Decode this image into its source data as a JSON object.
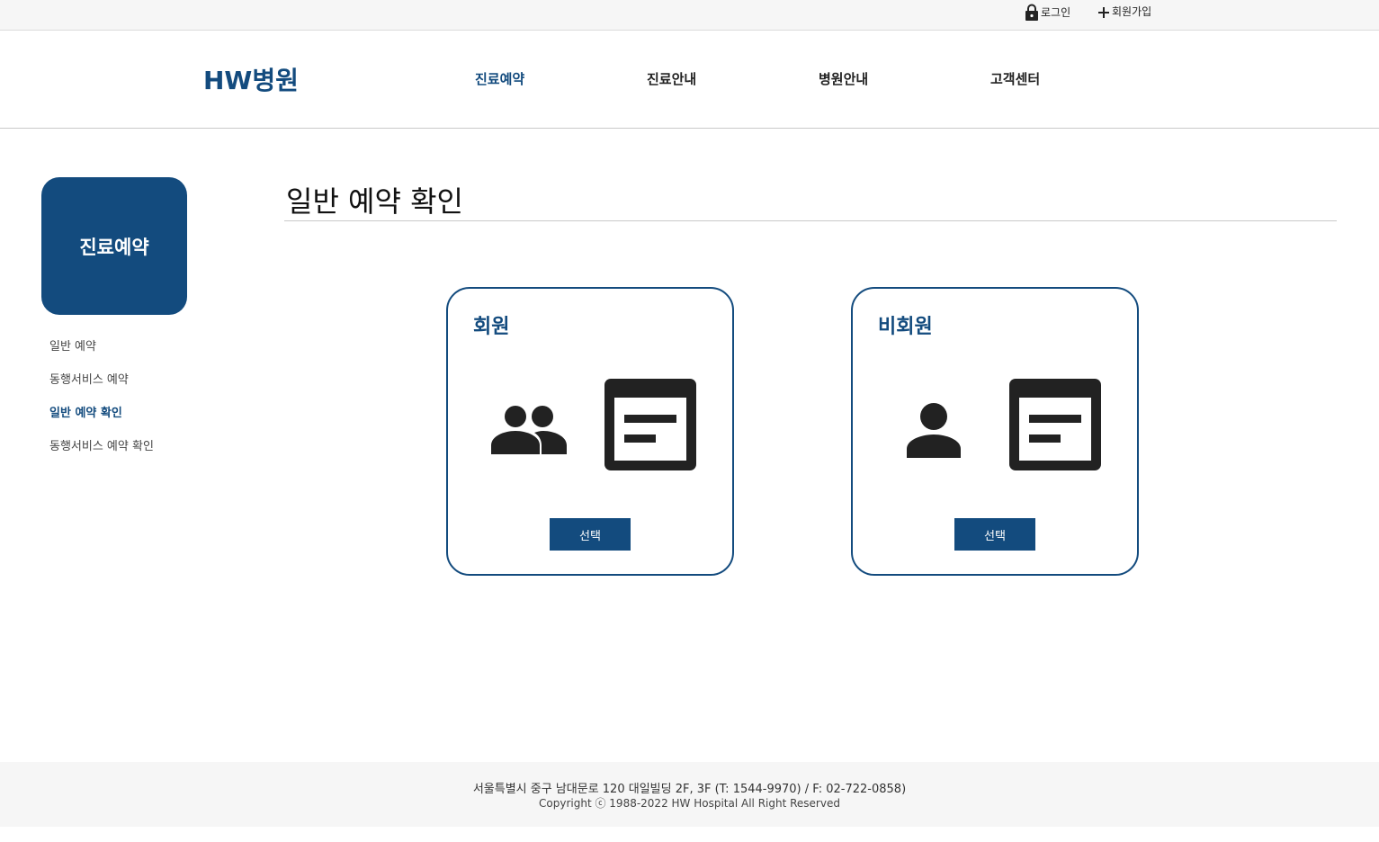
{
  "topbar": {
    "login_label": "로그인",
    "login_icon": "lock-icon",
    "join_label": "회원가입",
    "join_icon": "plus-icon"
  },
  "header": {
    "logo": "HW병원",
    "nav": [
      {
        "label": "진료예약",
        "active": true
      },
      {
        "label": "진료안내",
        "active": false
      },
      {
        "label": "병원안내",
        "active": false
      },
      {
        "label": "고객센터",
        "active": false
      }
    ]
  },
  "sidebar": {
    "title": "진료예약",
    "items": [
      {
        "label": "일반 예약",
        "active": false
      },
      {
        "label": "동행서비스 예약",
        "active": false
      },
      {
        "label": "일반 예약 확인",
        "active": true
      },
      {
        "label": "동행서비스 예약 확인",
        "active": false
      }
    ]
  },
  "main": {
    "title": "일반 예약 확인",
    "cards": [
      {
        "title": "회원",
        "icons": [
          "people-icon",
          "form-icon"
        ],
        "button": "선택"
      },
      {
        "title": "비회원",
        "icons": [
          "person-icon",
          "form-icon"
        ],
        "button": "선택"
      }
    ]
  },
  "footer": {
    "address": "서울특별시 중구 남대문로 120 대일빌딩 2F, 3F (T: 1544-9970) / F: 02-722-0858)",
    "copyright": "Copyright ⓒ 1988-2022 HW Hospital All Right Reserved"
  },
  "colors": {
    "brand": "#134b7e",
    "icon": "#222222",
    "topbar_bg": "#f6f6f6",
    "footer_bg": "#f6f6f6"
  }
}
